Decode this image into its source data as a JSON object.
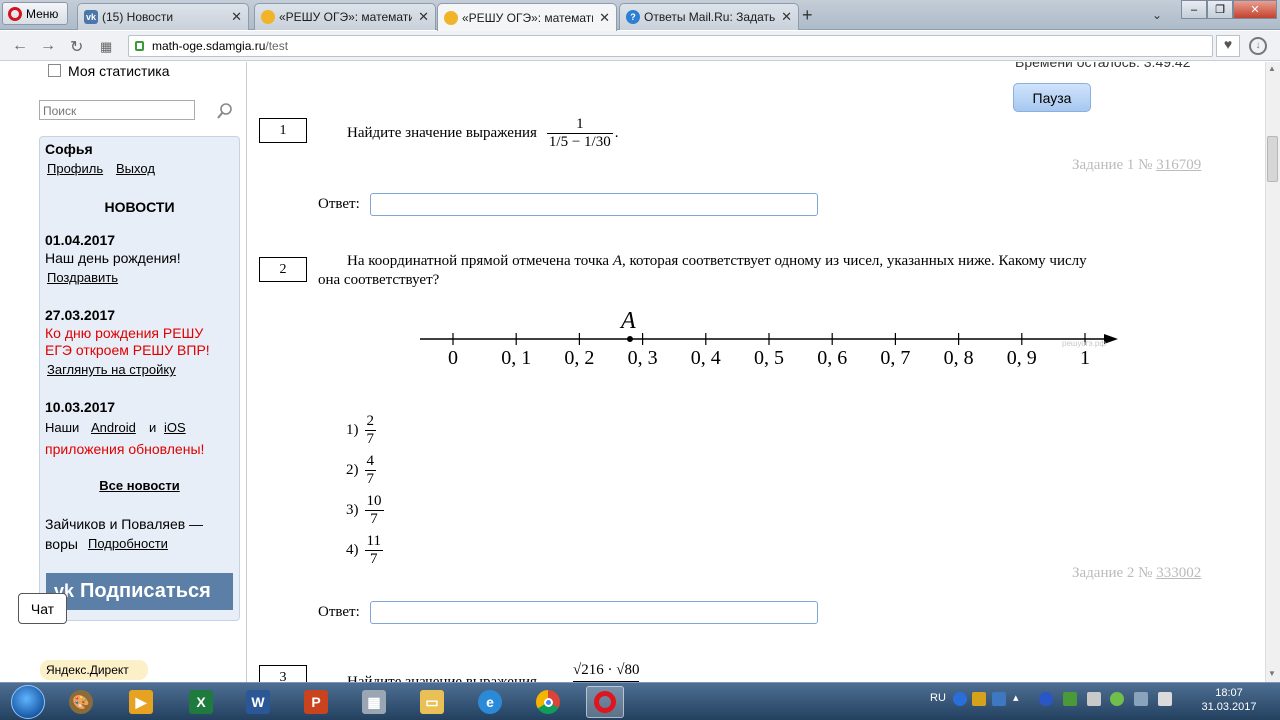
{
  "browser": {
    "menu_label": "Меню",
    "tabs": [
      {
        "title": "(15) Новости",
        "favicon": "vk-icon"
      },
      {
        "title": "«РЕШУ ОГЭ»: математика",
        "favicon": "sdamgia-icon"
      },
      {
        "title": "«РЕШУ ОГЭ»: математика",
        "favicon": "sdamgia-icon",
        "active": true
      },
      {
        "title": "Ответы Mail.Ru: Задать во",
        "favicon": "mailru-answers-icon"
      }
    ],
    "url_host": "math-oge.sdamgia.ru",
    "url_path": "/test"
  },
  "sidebar": {
    "stat_label": "Моя статистика",
    "search_placeholder": "Поиск",
    "user_name": "Софья",
    "profile_link": "Профиль",
    "logout_link": "Выход",
    "news_header": "НОВОСТИ",
    "news": [
      {
        "date": "01.04.2017",
        "line1": "Наш день рождения!",
        "link": "Поздравить"
      },
      {
        "date": "27.03.2017",
        "red1": "Ко дню рождения РЕШУ",
        "red2": "ЕГЭ откроем РЕШУ ВПР!",
        "link": "Заглянуть на стройку"
      },
      {
        "date": "10.03.2017",
        "pre": "Наши",
        "android": "Android",
        "and": "и",
        "ios": "iOS",
        "red": "приложения обновлены!"
      }
    ],
    "all_news": "Все новости",
    "extra_line1": "Зайчиков и Поваляев —",
    "extra_pre": "воры",
    "extra_link": "Подробности",
    "vk_button": "Подписаться",
    "chat_label": "Чат",
    "direct_label": "Яндекс.Директ"
  },
  "main": {
    "timer": "Времени осталось: 3:49:42",
    "pause_label": "Пауза",
    "answer_label": "Ответ:",
    "questions": [
      {
        "number": "1",
        "text": "Найдите значение выражения",
        "frac_num": "1",
        "frac_den": "1/5 − 1/30",
        "task_label": "Задание 1 №",
        "task_id": "316709"
      },
      {
        "number": "2",
        "text_line1": "На координатной прямой отмечена точка",
        "point": "A",
        "text_line1b": ", которая соответствует одному из чисел, указанных ниже. Какому числу",
        "text_line2": "она соответствует?",
        "axis_ticks": [
          "0",
          "0, 1",
          "0, 2",
          "0, 3",
          "0, 4",
          "0, 5",
          "0, 6",
          "0, 7",
          "0, 8",
          "0, 9",
          "1"
        ],
        "point_value": 0.28,
        "watermark": "решуогэ.рф",
        "options": [
          {
            "n": "1)",
            "num": "2",
            "den": "7"
          },
          {
            "n": "2)",
            "num": "4",
            "den": "7"
          },
          {
            "n": "3)",
            "num": "10",
            "den": "7"
          },
          {
            "n": "4)",
            "num": "11",
            "den": "7"
          }
        ],
        "task_label": "Задание 2 №",
        "task_id": "333002"
      },
      {
        "number": "3",
        "text": "Найдите значение выражения"
      }
    ]
  },
  "taskbar": {
    "lang": "RU",
    "time": "18:07",
    "date": "31.03.2017"
  }
}
